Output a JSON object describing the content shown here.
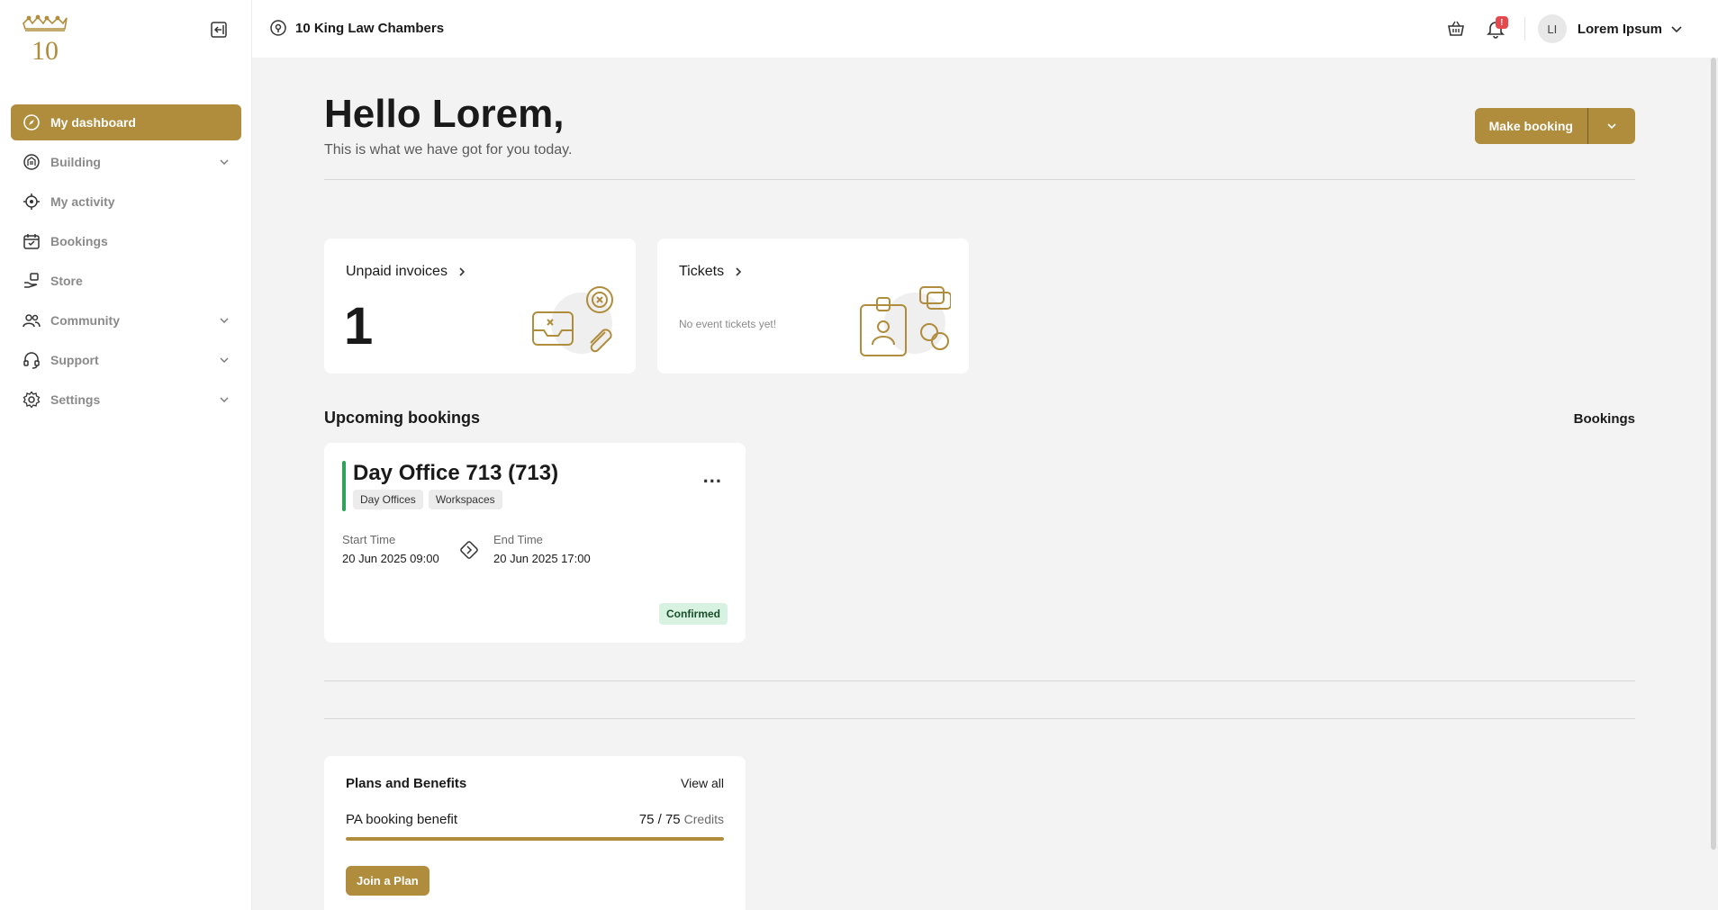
{
  "app": {
    "logo_text": "10",
    "accent": "#b08d3d"
  },
  "sidebar": {
    "items": [
      {
        "label": "My dashboard",
        "icon": "compass-icon",
        "active": true,
        "has_submenu": false
      },
      {
        "label": "Building",
        "icon": "building-icon",
        "active": false,
        "has_submenu": true
      },
      {
        "label": "My activity",
        "icon": "target-icon",
        "active": false,
        "has_submenu": false
      },
      {
        "label": "Bookings",
        "icon": "calendar-icon",
        "active": false,
        "has_submenu": false
      },
      {
        "label": "Store",
        "icon": "store-icon",
        "active": false,
        "has_submenu": false
      },
      {
        "label": "Community",
        "icon": "people-icon",
        "active": false,
        "has_submenu": true
      },
      {
        "label": "Support",
        "icon": "headset-icon",
        "active": false,
        "has_submenu": true
      },
      {
        "label": "Settings",
        "icon": "gear-icon",
        "active": false,
        "has_submenu": true
      }
    ]
  },
  "topbar": {
    "location": "10 King Law Chambers",
    "notification_badge": "!",
    "user_initials": "LI",
    "user_name": "Lorem Ipsum"
  },
  "header": {
    "greeting": "Hello Lorem,",
    "subtitle": "This is what we have got for you today.",
    "make_booking_label": "Make booking"
  },
  "cards": {
    "invoices": {
      "title": "Unpaid invoices",
      "count": "1"
    },
    "tickets": {
      "title": "Tickets",
      "empty_text": "No event tickets yet!"
    }
  },
  "upcoming": {
    "title": "Upcoming bookings",
    "link": "Bookings",
    "booking": {
      "title": "Day Office 713 (713)",
      "tags": [
        "Day Offices",
        "Workspaces"
      ],
      "start_label": "Start Time",
      "start_value": "20 Jun 2025 09:00",
      "end_label": "End Time",
      "end_value": "20 Jun 2025 17:00",
      "status": "Confirmed",
      "menu": "..."
    }
  },
  "plans": {
    "title": "Plans and Benefits",
    "view_all": "View all",
    "benefit_name": "PA booking benefit",
    "benefit_value": "75 / 75",
    "benefit_unit": "Credits",
    "benefit_fraction": 1.0,
    "join_label": "Join a Plan"
  }
}
